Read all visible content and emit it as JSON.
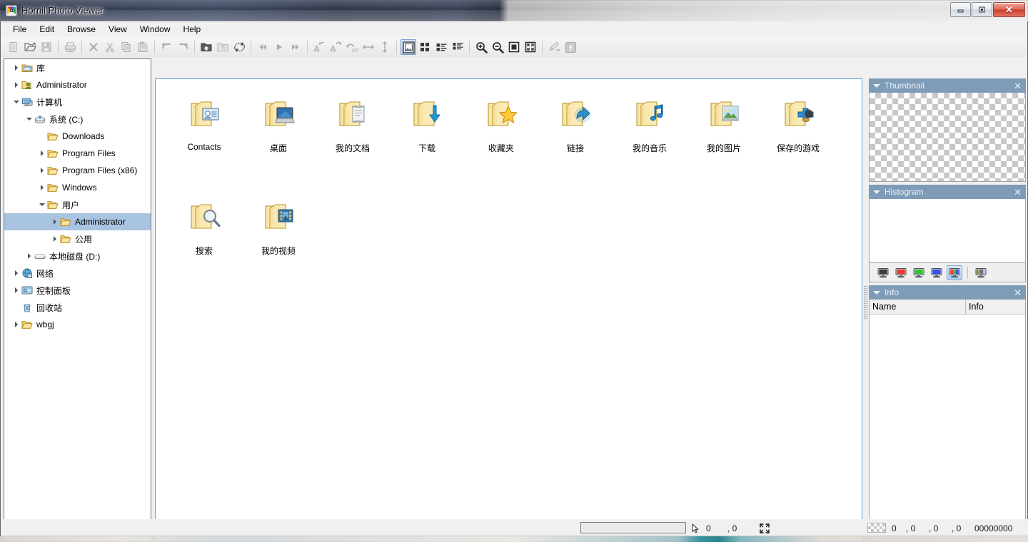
{
  "window": {
    "title": "Hornil Photo Viewer",
    "app_icon": "hornil-logo-icon",
    "minimize_label": "–",
    "maximize_label": "□",
    "close_label": "✕"
  },
  "menubar": {
    "items": [
      {
        "label": "File",
        "name": "menu-file"
      },
      {
        "label": "Edit",
        "name": "menu-edit"
      },
      {
        "label": "Browse",
        "name": "menu-browse"
      },
      {
        "label": "View",
        "name": "menu-view"
      },
      {
        "label": "Window",
        "name": "menu-window"
      },
      {
        "label": "Help",
        "name": "menu-help"
      }
    ]
  },
  "toolbar": {
    "buttons": [
      {
        "icon": "new-document-icon",
        "title": "New",
        "enabled": false,
        "active": false
      },
      {
        "icon": "open-folder-icon",
        "title": "Open",
        "enabled": true,
        "active": false
      },
      {
        "icon": "save-floppy-icon",
        "title": "Save",
        "enabled": false,
        "active": false
      },
      {
        "sep": true
      },
      {
        "icon": "printer-icon",
        "title": "Print",
        "enabled": false,
        "active": false
      },
      {
        "sep": true
      },
      {
        "icon": "delete-x-icon",
        "title": "Delete",
        "enabled": false,
        "active": false
      },
      {
        "icon": "scissors-cut-icon",
        "title": "Cut",
        "enabled": false,
        "active": false
      },
      {
        "icon": "copy-icon",
        "title": "Copy",
        "enabled": false,
        "active": false
      },
      {
        "icon": "paste-icon",
        "title": "Paste",
        "enabled": false,
        "active": false
      },
      {
        "sep": true
      },
      {
        "icon": "undo-arrow-icon",
        "title": "Undo",
        "enabled": false,
        "active": false
      },
      {
        "icon": "redo-arrow-icon",
        "title": "Redo",
        "enabled": false,
        "active": false
      },
      {
        "sep": true
      },
      {
        "icon": "folder-up-icon",
        "title": "Up one level",
        "enabled": true,
        "active": false
      },
      {
        "icon": "folder-new-icon",
        "title": "New folder",
        "enabled": false,
        "active": false
      },
      {
        "icon": "refresh-icon",
        "title": "Refresh",
        "enabled": true,
        "active": false
      },
      {
        "sep": true
      },
      {
        "icon": "skip-first-icon",
        "title": "First",
        "enabled": false,
        "active": false
      },
      {
        "icon": "play-next-icon",
        "title": "Next",
        "enabled": false,
        "active": false
      },
      {
        "icon": "skip-last-icon",
        "title": "Last",
        "enabled": false,
        "active": false
      },
      {
        "sep": true
      },
      {
        "icon": "rotate-left-icon",
        "title": "Rotate left",
        "enabled": false,
        "active": false
      },
      {
        "icon": "rotate-right-icon",
        "title": "Rotate right",
        "enabled": false,
        "active": false
      },
      {
        "icon": "rotate-180-icon",
        "title": "Rotate 180°",
        "enabled": false,
        "active": false
      },
      {
        "icon": "flip-horizontal-icon",
        "title": "Flip horizontal",
        "enabled": false,
        "active": false
      },
      {
        "icon": "flip-vertical-icon",
        "title": "Flip vertical",
        "enabled": false,
        "active": false
      },
      {
        "sep": true
      },
      {
        "icon": "view-thumbnail-icon",
        "title": "Thumbnails",
        "enabled": true,
        "active": true
      },
      {
        "icon": "view-tiles-icon",
        "title": "Tiles",
        "enabled": true,
        "active": false
      },
      {
        "icon": "view-list-icon",
        "title": "List",
        "enabled": true,
        "active": false
      },
      {
        "icon": "view-details-icon",
        "title": "Details",
        "enabled": true,
        "active": false
      },
      {
        "sep": true
      },
      {
        "icon": "zoom-in-icon",
        "title": "Zoom in",
        "enabled": true,
        "active": false
      },
      {
        "icon": "zoom-out-icon",
        "title": "Zoom out",
        "enabled": true,
        "active": false
      },
      {
        "icon": "actual-size-icon",
        "title": "Actual size",
        "enabled": true,
        "active": false
      },
      {
        "icon": "fit-window-icon",
        "title": "Fit to window",
        "enabled": true,
        "active": false
      },
      {
        "sep": true
      },
      {
        "icon": "edit-pencil-icon",
        "title": "Edit image",
        "enabled": false,
        "active": false
      },
      {
        "icon": "facebook-share-icon",
        "title": "Share",
        "enabled": false,
        "active": false
      }
    ]
  },
  "tree": {
    "items": [
      {
        "label": "库",
        "indent": 0,
        "twisty": "closed",
        "icon": "library-icon",
        "selected": false
      },
      {
        "label": "Administrator",
        "indent": 0,
        "twisty": "closed",
        "icon": "user-folder-icon",
        "selected": false
      },
      {
        "label": "计算机",
        "indent": 0,
        "twisty": "open",
        "icon": "computer-icon",
        "selected": false
      },
      {
        "label": "系统 (C:)",
        "indent": 1,
        "twisty": "open",
        "icon": "system-drive-icon",
        "selected": false
      },
      {
        "label": "Downloads",
        "indent": 2,
        "twisty": "none",
        "icon": "folder-icon",
        "selected": false
      },
      {
        "label": "Program Files",
        "indent": 2,
        "twisty": "closed",
        "icon": "folder-icon",
        "selected": false
      },
      {
        "label": "Program Files (x86)",
        "indent": 2,
        "twisty": "closed",
        "icon": "folder-icon",
        "selected": false
      },
      {
        "label": "Windows",
        "indent": 2,
        "twisty": "closed",
        "icon": "folder-icon",
        "selected": false
      },
      {
        "label": "用户",
        "indent": 2,
        "twisty": "open",
        "icon": "folder-icon",
        "selected": false
      },
      {
        "label": "Administrator",
        "indent": 3,
        "twisty": "closed",
        "icon": "folder-icon",
        "selected": true
      },
      {
        "label": "公用",
        "indent": 3,
        "twisty": "closed",
        "icon": "folder-icon",
        "selected": false
      },
      {
        "label": "本地磁盘 (D:)",
        "indent": 1,
        "twisty": "closed",
        "icon": "hdd-icon",
        "selected": false
      },
      {
        "label": "网络",
        "indent": 0,
        "twisty": "closed",
        "icon": "network-icon",
        "selected": false
      },
      {
        "label": "控制面板",
        "indent": 0,
        "twisty": "closed",
        "icon": "control-panel-icon",
        "selected": false
      },
      {
        "label": "回收站",
        "indent": 0,
        "twisty": "none",
        "icon": "recycle-bin-icon",
        "selected": false
      },
      {
        "label": "wbgj",
        "indent": 0,
        "twisty": "closed",
        "icon": "folder-icon",
        "selected": false
      }
    ]
  },
  "content": {
    "files": [
      {
        "label": "Contacts",
        "icon": "folder-contacts-icon"
      },
      {
        "label": "桌面",
        "icon": "folder-desktop-icon"
      },
      {
        "label": "我的文档",
        "icon": "folder-documents-icon"
      },
      {
        "label": "下载",
        "icon": "folder-downloads-icon"
      },
      {
        "label": "收藏夹",
        "icon": "folder-favorites-icon"
      },
      {
        "label": "链接",
        "icon": "folder-links-icon"
      },
      {
        "label": "我的音乐",
        "icon": "folder-music-icon"
      },
      {
        "label": "我的图片",
        "icon": "folder-pictures-icon"
      },
      {
        "label": "保存的游戏",
        "icon": "folder-savedgames-icon"
      },
      {
        "label": "搜索",
        "icon": "folder-searches-icon"
      },
      {
        "label": "我的视频",
        "icon": "folder-videos-icon"
      }
    ]
  },
  "panels": {
    "thumbnail": {
      "title": "Thumbnail",
      "close_label": "✕"
    },
    "histogram": {
      "title": "Histogram",
      "close_label": "✕",
      "channels": [
        {
          "name": "channel-luminance",
          "color": "#3c3c3c",
          "active": false
        },
        {
          "name": "channel-red",
          "color": "#e83b2e",
          "active": false
        },
        {
          "name": "channel-green",
          "color": "#35c235",
          "active": false
        },
        {
          "name": "channel-blue",
          "color": "#3a4ce0",
          "active": false
        },
        {
          "name": "channel-rgb",
          "color": "#rgb",
          "active": true
        },
        {
          "sep": true
        },
        {
          "name": "channel-all",
          "color": "#multi",
          "active": false
        }
      ]
    },
    "info": {
      "title": "Info",
      "close_label": "✕",
      "columns": [
        "Name",
        "Info"
      ],
      "rows": []
    }
  },
  "statusbar": {
    "path_value": "",
    "path_placeholder": "",
    "cursor_icon": "mouse-pointer-icon",
    "cursor_x": "0",
    "cursor_sep": ", 0",
    "size_icon": "resize-arrows-icon",
    "color_swatch": "transparent-checker-swatch",
    "rgba": [
      "0",
      ", 0",
      ", 0",
      ", 0"
    ],
    "hex": "00000000"
  }
}
